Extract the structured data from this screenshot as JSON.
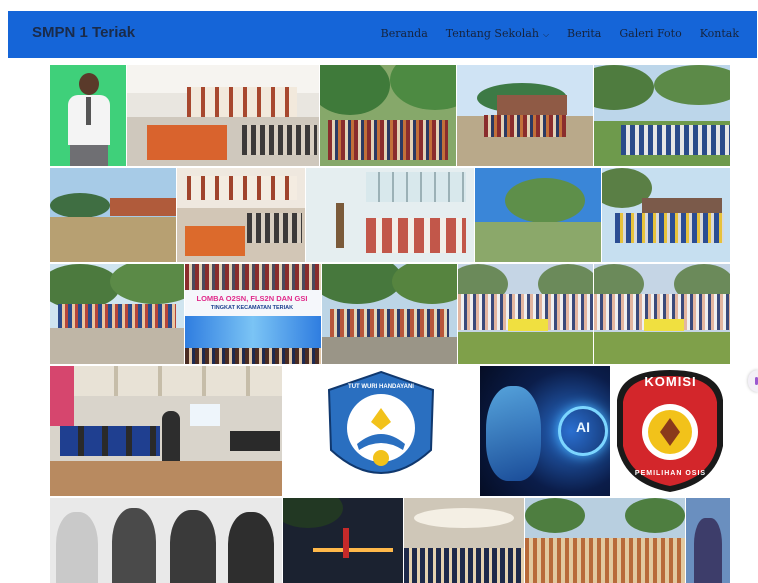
{
  "site": {
    "title": "SMPN 1 Teriak"
  },
  "nav": {
    "items": [
      "Beranda",
      "Tentang Sekolah",
      "Berita",
      "Galeri Foto",
      "Kontak"
    ]
  },
  "banners": {
    "lomba_line1": "LOMBA O2SN, FLS2N DAN GSI",
    "lomba_line2": "TINGKAT KECAMATAN TERIAK"
  },
  "logos": {
    "tut_wuri": "TUT WURI HANDAYANI",
    "ai": "AI",
    "komisi_top": "KOMISI",
    "komisi_bottom": "PEMILIHAN OSIS"
  },
  "colors": {
    "nav_bg": "#1565d8",
    "brand_text": "#1a2b4a",
    "komisi_red": "#d3262b",
    "tutwuri_blue": "#2a6fc0"
  }
}
